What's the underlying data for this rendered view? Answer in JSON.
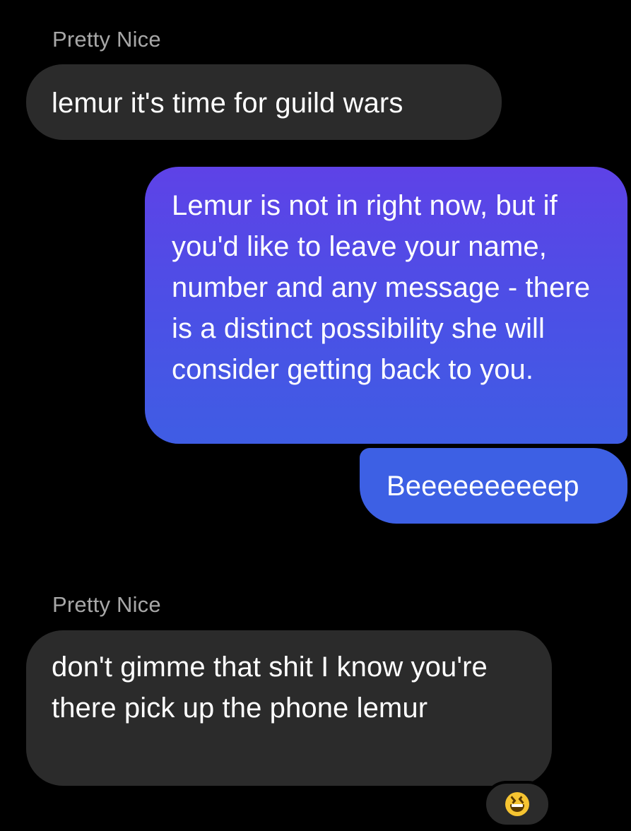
{
  "conversation": {
    "messages": [
      {
        "sender": "Pretty Nice",
        "direction": "incoming",
        "text": "lemur it's time for guild wars"
      },
      {
        "direction": "outgoing",
        "text": "Lemur is not in right now, but if you'd like to leave your name, number and any message - there is a distinct possibility she will consider getting back to you."
      },
      {
        "direction": "outgoing",
        "text": "Beeeeeeeeeep"
      },
      {
        "sender": "Pretty Nice",
        "direction": "incoming",
        "text": "don't gimme that shit I know you're there pick up the phone lemur",
        "reaction": "laughing-squinting-face-emoji"
      }
    ]
  },
  "colors": {
    "background": "#000000",
    "incoming_bubble": "#2b2b2b",
    "outgoing_gradient_top": "#5e42e7",
    "outgoing_gradient_bottom": "#3f5de4",
    "sender_name": "#a7a7a7"
  }
}
